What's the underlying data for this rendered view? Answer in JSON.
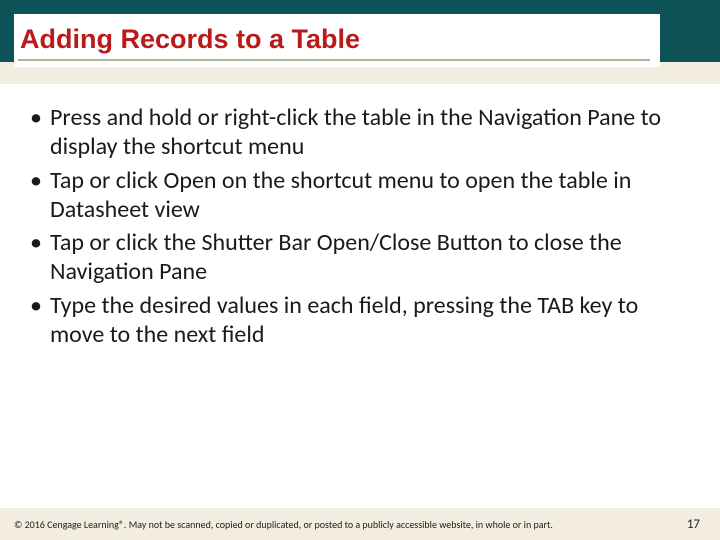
{
  "title": "Adding Records to a Table",
  "bullets": [
    "Press and hold or right-click the table in the Navigation Pane to display the shortcut menu",
    "Tap or click Open on the shortcut menu to open the table in Datasheet view",
    "Tap or click the Shutter Bar Open/Close Button to close the Navigation Pane",
    "Type the desired values in each field, pressing the TAB key to move to the next field"
  ],
  "footer": {
    "copyright": "© 2016 Cengage Learning®. May not be scanned, copied or duplicated, or posted to a publicly accessible website, in whole or in part.",
    "page": "17"
  }
}
